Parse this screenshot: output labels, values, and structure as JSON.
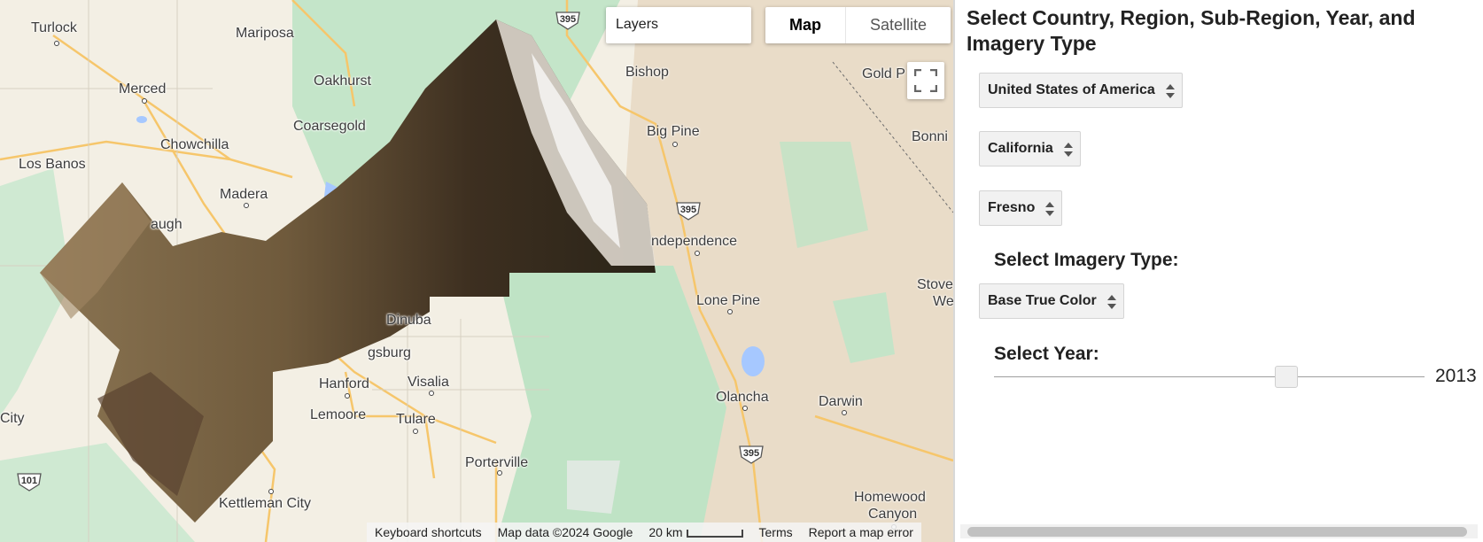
{
  "map": {
    "places": [
      {
        "name": "Turlock"
      },
      {
        "name": "Mariposa"
      },
      {
        "name": "Merced"
      },
      {
        "name": "Oakhurst"
      },
      {
        "name": "Coarsegold"
      },
      {
        "name": "Chowchilla"
      },
      {
        "name": "Los Banos"
      },
      {
        "name": "Madera"
      },
      {
        "name": "augh"
      },
      {
        "name": "Bishop"
      },
      {
        "name": "Big Pine"
      },
      {
        "name": "Gold P"
      },
      {
        "name": "Bonni"
      },
      {
        "name": "ndependence"
      },
      {
        "name": "Lone Pine"
      },
      {
        "name": "Stove"
      },
      {
        "name": "We"
      },
      {
        "name": "Dinuba"
      },
      {
        "name": "gsburg"
      },
      {
        "name": "Hanford"
      },
      {
        "name": "Visalia"
      },
      {
        "name": "Lemoore"
      },
      {
        "name": "Tulare"
      },
      {
        "name": "Olancha"
      },
      {
        "name": "Darwin"
      },
      {
        "name": "Porterville"
      },
      {
        "name": "City"
      },
      {
        "name": "Kettleman City"
      },
      {
        "name": "Homewood"
      },
      {
        "name": "Canyon"
      }
    ],
    "shields": [
      {
        "num": "395"
      },
      {
        "num": "395"
      },
      {
        "num": "395"
      },
      {
        "num": "101"
      }
    ],
    "layers_label": "Layers",
    "maptype": {
      "map": "Map",
      "satellite": "Satellite"
    },
    "footer": {
      "shortcuts": "Keyboard shortcuts",
      "data": "Map data ©2024 Google",
      "scale": "20 km",
      "terms": "Terms",
      "report": "Report a map error"
    }
  },
  "panel": {
    "title": "Select Country, Region, Sub-Region, Year, and Imagery Type",
    "country": "United States of America",
    "region": "California",
    "subregion": "Fresno",
    "imagery_heading": "Select Imagery Type:",
    "imagery": "Base True Color",
    "year_heading": "Select Year:",
    "year": "2013",
    "year_slider_fraction": 0.68
  },
  "colors": {
    "land": "#f3efe4",
    "park": "#bfe3c5",
    "road": "#f6c66b",
    "accent": "#1a73e8"
  }
}
